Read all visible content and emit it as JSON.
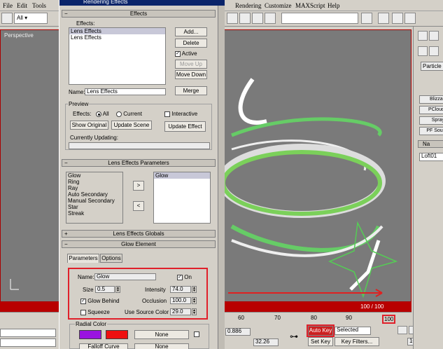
{
  "menu": [
    "File",
    "Edit",
    "Tools",
    "Rendering",
    "Customize",
    "MAXScript",
    "Help"
  ],
  "toolbar": {
    "selection_filter": "All"
  },
  "viewport": {
    "label": "Perspective"
  },
  "timeline": {
    "frame_counter": "100 / 100",
    "ticks": [
      "60",
      "70",
      "80",
      "90",
      "100"
    ]
  },
  "status": {
    "coord_x": "0.886",
    "coord_y": "32.26",
    "auto_key": "Auto Key",
    "set_key": "Set Key",
    "selected": "Selected",
    "key_filters": "Key Filters...",
    "frame": "100"
  },
  "command_panel": {
    "tab": "Particle",
    "buttons": [
      "Blizzar",
      "PCloud",
      "Spray",
      "PF Sour"
    ],
    "name_rollout": "Na",
    "object_name": "Loft01"
  },
  "dialog": {
    "title": "Rendering Effects",
    "effects_rollout": "Effects",
    "effects_label": "Effects:",
    "effects_list": [
      "Lens Effects",
      "Lens Effects"
    ],
    "add": "Add...",
    "delete": "Delete",
    "active": "Active",
    "move_up": "Move Up",
    "move_down": "Move Down",
    "name_label": "Name:",
    "name_value": "Lens Effects",
    "merge": "Merge",
    "preview_label": "Preview",
    "preview_effects": "Effects:",
    "all": "All",
    "current": "Current",
    "interactive": "Interactive",
    "show_original": "Show Original",
    "update_scene": "Update Scene",
    "update_effect": "Update Effect",
    "currently_updating": "Currently Updating:",
    "params_rollout": "Lens Effects Parameters",
    "left_list": [
      "Glow",
      "Ring",
      "Ray",
      "Auto Secondary",
      "Manual Secondary",
      "Star",
      "Streak"
    ],
    "right_list": [
      "Glow"
    ],
    "arrow_right": ">",
    "arrow_left": "<",
    "globals_rollout": "Lens Effects Globals",
    "glow_rollout": "Glow Element",
    "tab_parameters": "Parameters",
    "tab_options": "Options",
    "glow_name_label": "Name:",
    "glow_name": "Glow",
    "on": "On",
    "size_label": "Size",
    "size": "0.5",
    "intensity_label": "Intensity",
    "intensity": "74.0",
    "glow_behind": "Glow Behind",
    "occlusion_label": "Occlusion",
    "occlusion": "100.0",
    "squeeze": "Squeeze",
    "use_source_color_label": "Use Source Color",
    "use_source_color": "29.0",
    "radial_color": "Radial Color",
    "none1": "None",
    "falloff": "Falloff Curve",
    "none2": "None",
    "colors": {
      "purple": "#9a14e0",
      "red": "#ee1010"
    }
  }
}
